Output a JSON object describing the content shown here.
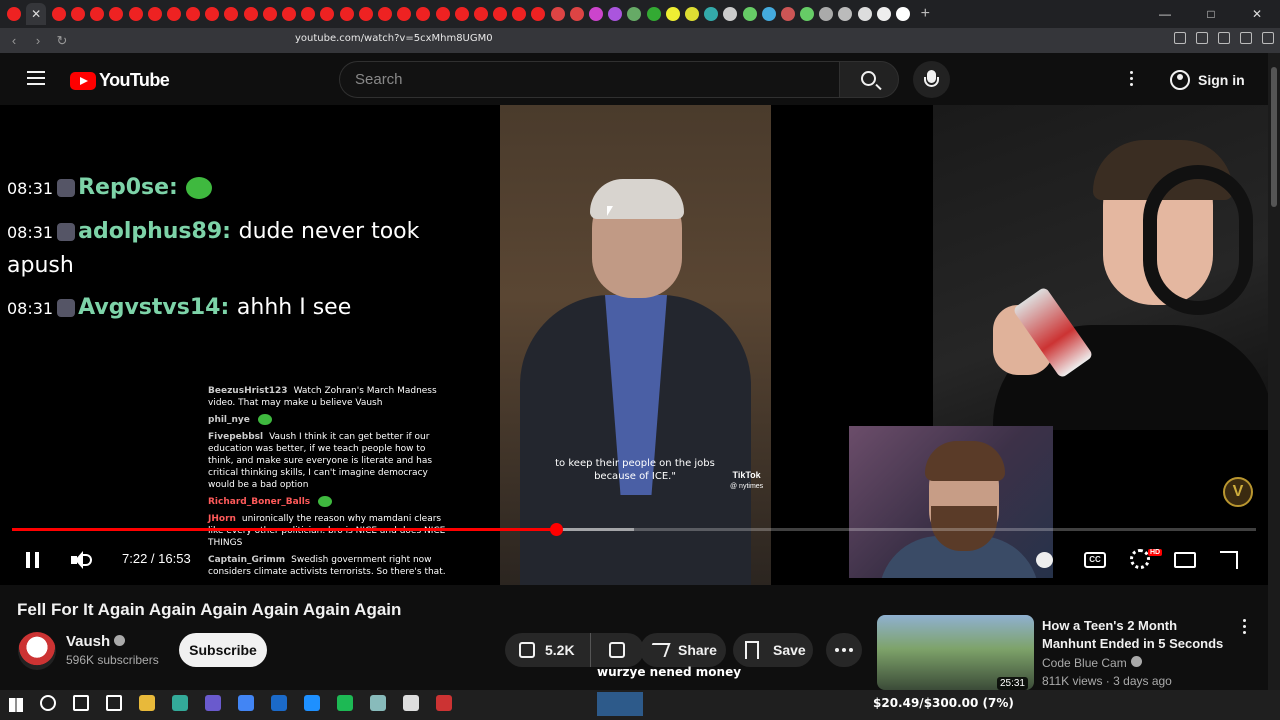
{
  "browser": {
    "url": "youtube.com/watch?v=5cxMhm8UGM0",
    "tab_colors": [
      "#e22",
      "#e22",
      "#e22",
      "#e22",
      "#e22",
      "#e22",
      "#e22",
      "#e22",
      "#e22",
      "#e22",
      "#e22",
      "#e22",
      "#e22",
      "#e22",
      "#e22",
      "#e22",
      "#e22",
      "#e22",
      "#e22",
      "#e22",
      "#e22",
      "#e22",
      "#e22",
      "#e22",
      "#e22",
      "#e22",
      "#e22",
      "#e22",
      "#d44",
      "#d44",
      "#c4c",
      "#a5d",
      "#6a6",
      "#3a3",
      "#ee3",
      "#dd3",
      "#3aa",
      "#ccc",
      "#6c6",
      "#4ad",
      "#c55",
      "#6c6",
      "#aaa",
      "#bbb",
      "#ddd",
      "#eee",
      "#fff"
    ]
  },
  "header": {
    "logo_text": "YouTube",
    "search_placeholder": "Search",
    "signin_label": "Sign in"
  },
  "chat": [
    {
      "time": "08:31",
      "user": "Rep0se",
      "message": ""
    },
    {
      "time": "08:31",
      "user": "adolphus89",
      "message": "dude never took apush"
    },
    {
      "time": "08:31",
      "user": "Avgvstvs14",
      "message": "ahhh I see"
    }
  ],
  "overlay_chat": [
    {
      "user": "BeezusHrist123",
      "message": "Watch Zohran's March Madness video. That may make u believe Vaush",
      "red": false
    },
    {
      "user": "phil_nye",
      "message": "",
      "red": false
    },
    {
      "user": "Fivepebbsl",
      "message": "Vaush I think it can get better if our education was better, if we teach people how to think, and make sure everyone is literate and has critical thinking skills, I can't imagine democracy would be a bad option",
      "red": false
    },
    {
      "user": "Richard_Boner_Balls",
      "message": "",
      "red": true
    },
    {
      "user": "JHorn",
      "message": "unironically the reason why mamdani clears like every other politician. bro is NICE and does NICE THINGS",
      "red": true
    },
    {
      "user": "Captain_Grimm",
      "message": "Swedish government right now considers climate activists terrorists. So there's that.",
      "red": false
    }
  ],
  "clip": {
    "caption": "to keep their people on the jobs because of ICE.\"",
    "tiktok_label": "TikTok",
    "tiktok_handle": "@ nytimes"
  },
  "player": {
    "current_time": "7:22",
    "duration": "16:53",
    "timecode": "7:22 / 16:53",
    "played_fraction": 0.437,
    "buffered_fraction": 0.5,
    "hd_badge": "HD",
    "cc_label": "CC",
    "channel_logo_letter": "V"
  },
  "video": {
    "title": "Fell For It Again Again Again Again Again Again",
    "channel": "Vaush",
    "subscribers": "596K subscribers",
    "subscribe_label": "Subscribe",
    "likes": "5.2K",
    "share_label": "Share",
    "save_label": "Save"
  },
  "overlay_text": "wurzye nened money",
  "recommendation": {
    "title": "How a Teen's 2 Month Manhunt Ended in 5 Seconds",
    "channel": "Code Blue Cam",
    "meta": "811K views · 3 days ago",
    "duration": "25:31"
  },
  "taskbar": {
    "money": "$20.49/$300.00 (7%)",
    "icon_colors": [
      "#fff",
      "#fff",
      "#fff",
      "#e8b93a",
      "#3a9",
      "#6a5acd",
      "#4285f4",
      "#1b6ac9",
      "#1e90ff",
      "#1db954",
      "#8bb",
      "#ddd",
      "#c33"
    ]
  }
}
